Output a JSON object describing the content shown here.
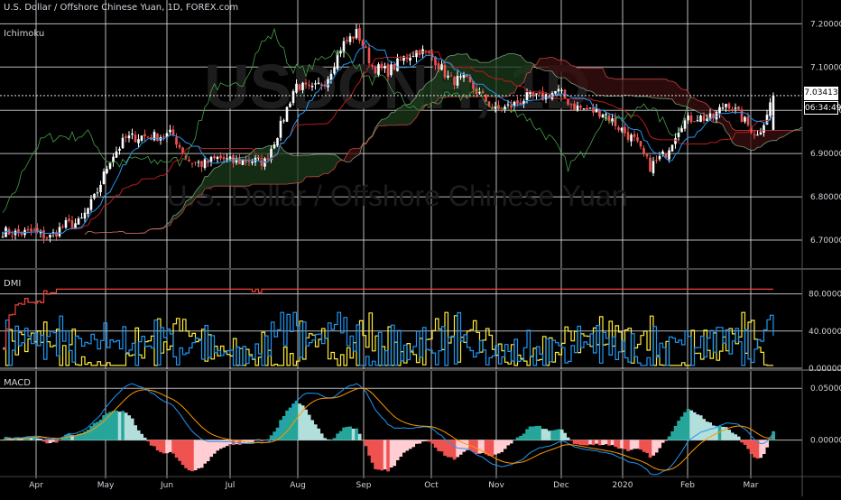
{
  "header": {
    "symbol_title": "U.S. Dollar / Offshore Chinese Yuan, 1D, FOREX.com"
  },
  "watermark": {
    "ticker": "USDCNH, 1D",
    "name": "U.S. Dollar / Offshore Chinese Yuan"
  },
  "panes": {
    "ichimoku_label": "Ichimoku",
    "dmi_label": "DMI",
    "macd_label": "MACD"
  },
  "price_axis": {
    "ticks": [
      "7.20000",
      "7.10000",
      "7.00000",
      "6.90000",
      "6.80000",
      "6.70000"
    ],
    "last_price": "7.03413",
    "countdown": "06:34:49"
  },
  "dmi_axis": {
    "ticks": [
      "80.00000",
      "40.00000",
      "0.00000"
    ]
  },
  "macd_axis": {
    "ticks": [
      "0.05000",
      "0.00000"
    ]
  },
  "time_axis": {
    "labels": [
      "Apr",
      "May",
      "Jun",
      "Jul",
      "Aug",
      "Sep",
      "Oct",
      "Nov",
      "Dec",
      "2020",
      "Feb",
      "Mar"
    ]
  },
  "colors": {
    "background": "#000000",
    "up": "#ffffff",
    "down": "#ef5350",
    "conversion": "#2196f3",
    "base": "#b71c1c",
    "lagging": "#43a047",
    "cloud_up": "#1b3a1b",
    "cloud_down": "#3a0f0f",
    "dmi_plus": "#2196f3",
    "dmi_minus": "#ffeb3b",
    "adx": "#f44336",
    "macd": "#2196f3",
    "signal": "#ff9800",
    "hist_up": "#26a69a",
    "hist_up_weak": "#b2dfdb",
    "hist_down": "#ef5350",
    "hist_down_weak": "#ffcdd2",
    "grid": "#d9d9d9"
  },
  "chart_data": {
    "type": "candlestick",
    "title": "U.S. Dollar / Offshore Chinese Yuan, 1D, FOREX.com",
    "ylim": [
      6.65,
      7.23
    ],
    "grid": true,
    "close_series": [
      {
        "date": "2019-03-25",
        "close": 6.72
      },
      {
        "date": "2019-04-01",
        "close": 6.715
      },
      {
        "date": "2019-04-08",
        "close": 6.72
      },
      {
        "date": "2019-04-15",
        "close": 6.705
      },
      {
        "date": "2019-04-22",
        "close": 6.735
      },
      {
        "date": "2019-04-29",
        "close": 6.74
      },
      {
        "date": "2019-05-06",
        "close": 6.8
      },
      {
        "date": "2019-05-13",
        "close": 6.89
      },
      {
        "date": "2019-05-20",
        "close": 6.935
      },
      {
        "date": "2019-05-27",
        "close": 6.94
      },
      {
        "date": "2019-06-03",
        "close": 6.94
      },
      {
        "date": "2019-06-10",
        "close": 6.945
      },
      {
        "date": "2019-06-17",
        "close": 6.885
      },
      {
        "date": "2019-06-24",
        "close": 6.875
      },
      {
        "date": "2019-07-01",
        "close": 6.89
      },
      {
        "date": "2019-07-08",
        "close": 6.88
      },
      {
        "date": "2019-07-15",
        "close": 6.885
      },
      {
        "date": "2019-07-22",
        "close": 6.88
      },
      {
        "date": "2019-07-29",
        "close": 6.96
      },
      {
        "date": "2019-08-05",
        "close": 7.06
      },
      {
        "date": "2019-08-12",
        "close": 7.045
      },
      {
        "date": "2019-08-19",
        "close": 7.07
      },
      {
        "date": "2019-08-26",
        "close": 7.15
      },
      {
        "date": "2019-09-02",
        "close": 7.18
      },
      {
        "date": "2019-09-09",
        "close": 7.1
      },
      {
        "date": "2019-09-16",
        "close": 7.09
      },
      {
        "date": "2019-09-23",
        "close": 7.12
      },
      {
        "date": "2019-09-30",
        "close": 7.14
      },
      {
        "date": "2019-10-07",
        "close": 7.12
      },
      {
        "date": "2019-10-14",
        "close": 7.07
      },
      {
        "date": "2019-10-21",
        "close": 7.07
      },
      {
        "date": "2019-10-28",
        "close": 7.035
      },
      {
        "date": "2019-11-04",
        "close": 7.0
      },
      {
        "date": "2019-11-11",
        "close": 7.01
      },
      {
        "date": "2019-11-18",
        "close": 7.03
      },
      {
        "date": "2019-11-25",
        "close": 7.03
      },
      {
        "date": "2019-12-02",
        "close": 7.045
      },
      {
        "date": "2019-12-09",
        "close": 7.01
      },
      {
        "date": "2019-12-16",
        "close": 7.0
      },
      {
        "date": "2019-12-23",
        "close": 6.995
      },
      {
        "date": "2019-12-30",
        "close": 6.96
      },
      {
        "date": "2020-01-06",
        "close": 6.93
      },
      {
        "date": "2020-01-13",
        "close": 6.87
      },
      {
        "date": "2020-01-20",
        "close": 6.9
      },
      {
        "date": "2020-01-27",
        "close": 6.97
      },
      {
        "date": "2020-02-03",
        "close": 6.985
      },
      {
        "date": "2020-02-10",
        "close": 6.98
      },
      {
        "date": "2020-02-17",
        "close": 7.02
      },
      {
        "date": "2020-02-24",
        "close": 6.98
      },
      {
        "date": "2020-03-02",
        "close": 6.94
      },
      {
        "date": "2020-03-09",
        "close": 7.034
      }
    ]
  }
}
